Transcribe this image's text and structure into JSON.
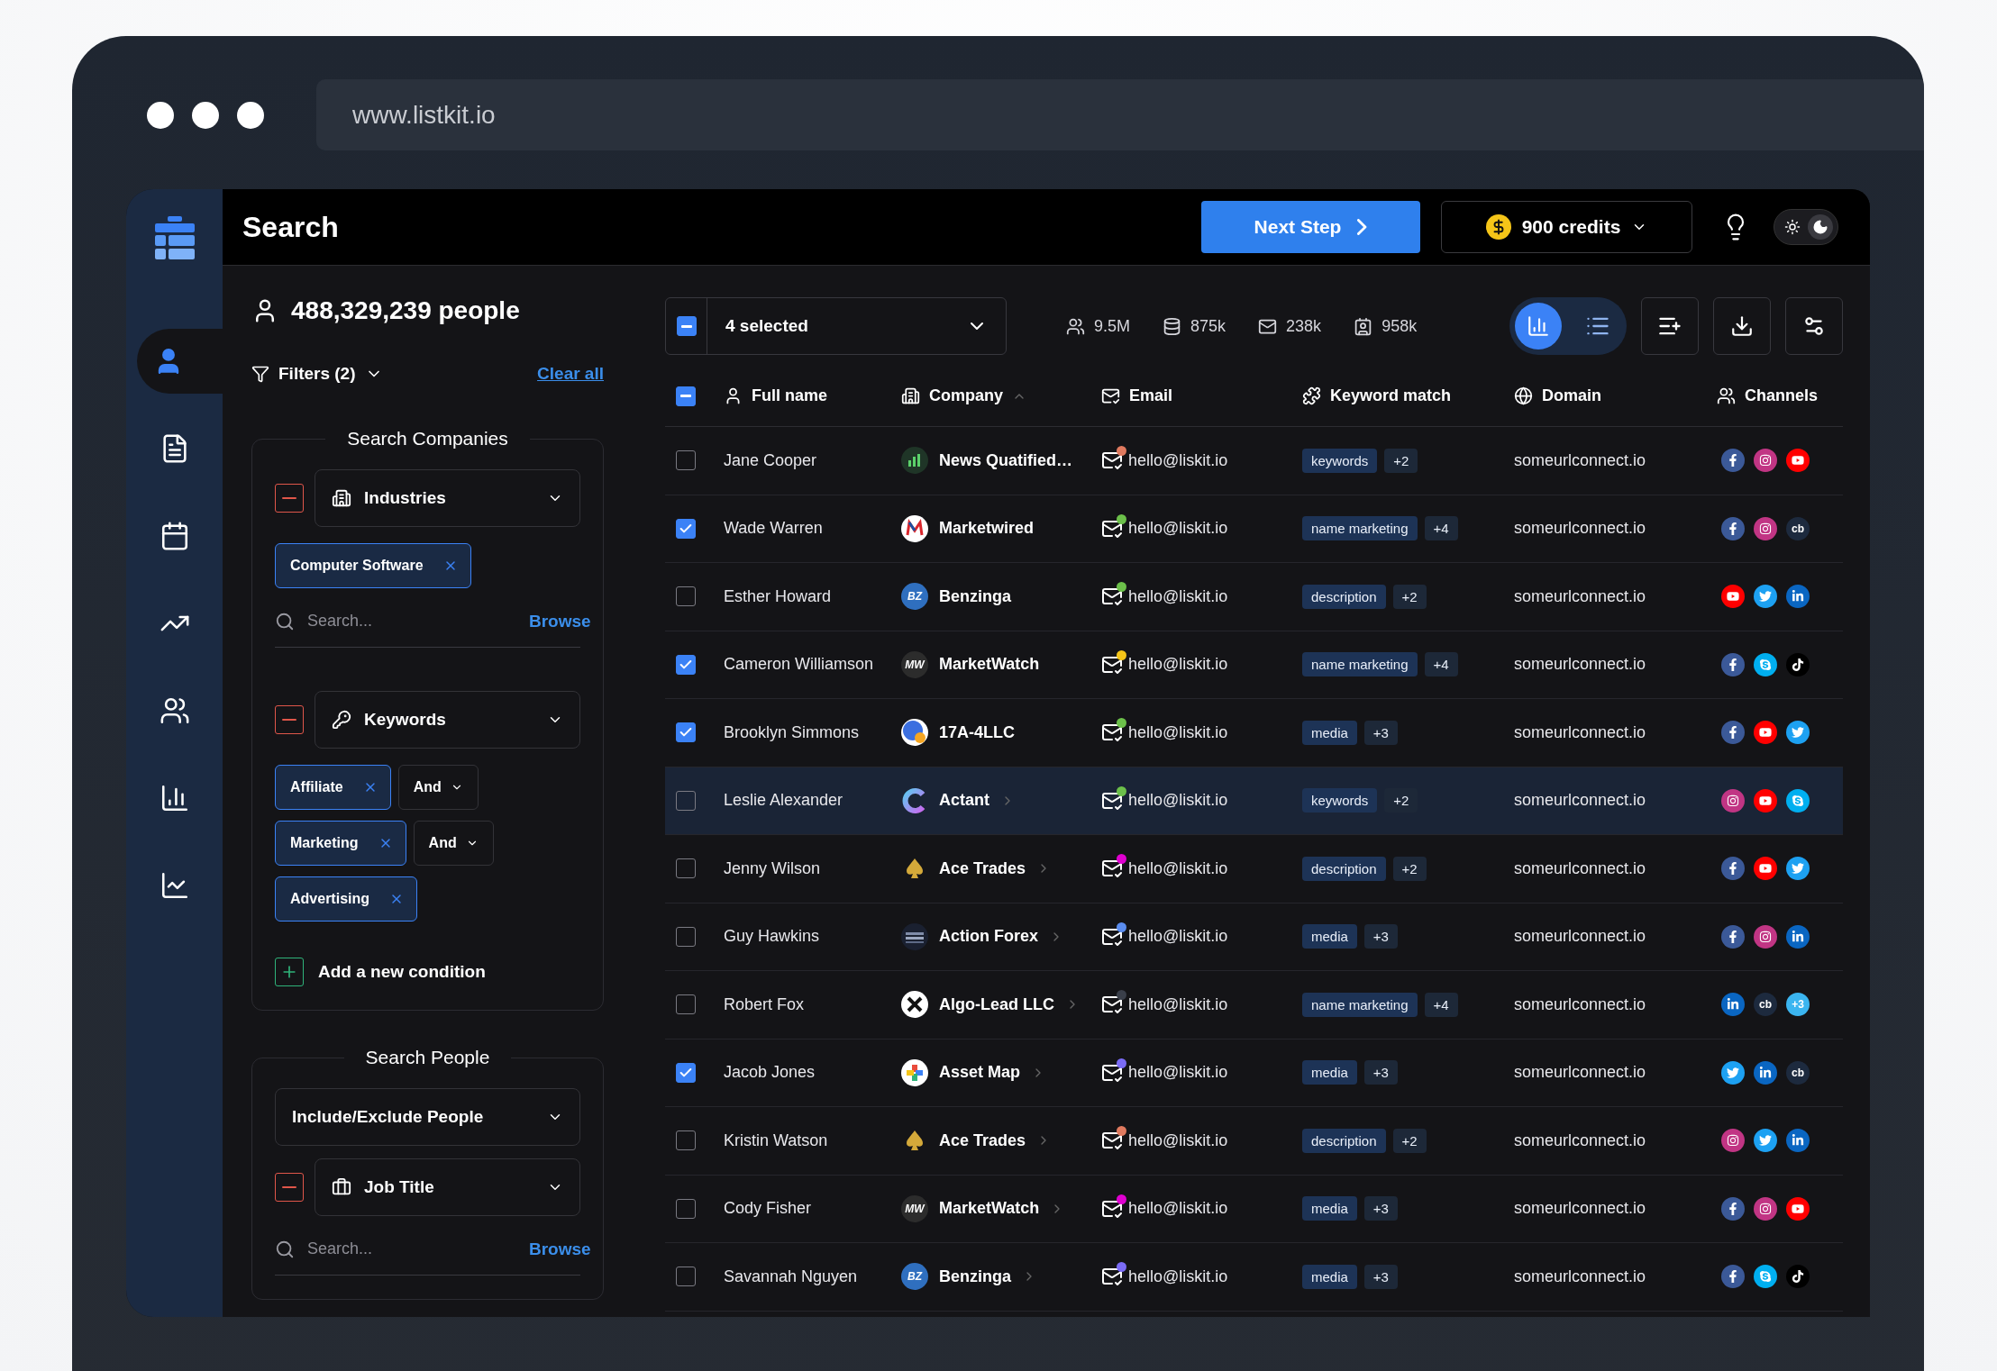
{
  "browser": {
    "url": "www.listkit.io"
  },
  "sidebar": {
    "items": [
      {
        "kind": "person",
        "selected": true
      },
      {
        "kind": "document",
        "selected": false
      },
      {
        "kind": "calendar",
        "selected": false
      },
      {
        "kind": "growth",
        "selected": false
      },
      {
        "kind": "team",
        "selected": false
      },
      {
        "kind": "bars",
        "selected": false
      },
      {
        "kind": "line",
        "selected": false
      }
    ]
  },
  "header": {
    "title": "Search",
    "next_button": "Next Step",
    "credits": "900 credits",
    "dark_mode": true
  },
  "filters_panel": {
    "people_count": "488,329,239 people",
    "filters_label": "Filters (2)",
    "clear_all": "Clear all",
    "sections": [
      {
        "title": "Search Companies",
        "conditions": [
          {
            "kind": "industry",
            "label": "Industries",
            "chips": [
              {
                "label": "Computer Software"
              }
            ],
            "search": {
              "placeholder": "Search...",
              "browse": "Browse"
            }
          },
          {
            "kind": "keyword",
            "label": "Keywords",
            "chips": [
              {
                "label": "Affiliate",
                "operator": "And"
              },
              {
                "label": "Marketing",
                "operator": "And"
              },
              {
                "label": "Advertising"
              }
            ]
          }
        ],
        "add_condition": "Add a new condition"
      },
      {
        "title": "Search People",
        "include_select": "Include/Exclude People",
        "conditions": [
          {
            "kind": "job",
            "label": "Job Title",
            "search": {
              "placeholder": "Search...",
              "browse": "Browse"
            }
          }
        ]
      }
    ]
  },
  "toolbar": {
    "selection": "4 selected",
    "indeterminate": true,
    "stats": [
      {
        "kind": "people",
        "value": "9.5M"
      },
      {
        "kind": "companies",
        "value": "875k"
      },
      {
        "kind": "emails",
        "value": "238k"
      },
      {
        "kind": "contacts",
        "value": "958k"
      }
    ],
    "views": [
      {
        "kind": "chart",
        "selected": true
      },
      {
        "kind": "list",
        "selected": false
      }
    ]
  },
  "table": {
    "indeterminate": true,
    "columns": [
      {
        "kind": "name",
        "label": "Full name",
        "sorted": false
      },
      {
        "kind": "company",
        "label": "Company",
        "sorted": true
      },
      {
        "kind": "email",
        "label": "Email",
        "sorted": false
      },
      {
        "kind": "keyword",
        "label": "Keyword match",
        "sorted": false
      },
      {
        "kind": "domain",
        "label": "Domain",
        "sorted": false
      },
      {
        "kind": "channels",
        "label": "Channels",
        "sorted": false
      }
    ],
    "rows": [
      {
        "selected": false,
        "highlighted": false,
        "name": "Jane Cooper",
        "company": "News Quatified…",
        "logo": {
          "kind": "news"
        },
        "expandable": false,
        "email": "hello@liskit.io",
        "color": "#e07a5f",
        "keyword": "keywords",
        "extra": "+2",
        "domain": "someurlconnect.io",
        "channels": [
          {
            "kind": "facebook"
          },
          {
            "kind": "instagram"
          },
          {
            "kind": "youtube"
          }
        ]
      },
      {
        "selected": true,
        "highlighted": false,
        "name": "Wade Warren",
        "company": "Marketwired",
        "logo": {
          "kind": "marketwired"
        },
        "expandable": false,
        "email": "hello@liskit.io",
        "color": "#6cc04a",
        "keyword": "name marketing",
        "extra": "+4",
        "domain": "someurlconnect.io",
        "channels": [
          {
            "kind": "facebook"
          },
          {
            "kind": "instagram"
          },
          {
            "kind": "text",
            "label": "cb"
          }
        ]
      },
      {
        "selected": false,
        "highlighted": false,
        "name": "Esther Howard",
        "company": "Benzinga",
        "logo": {
          "kind": "monogram",
          "text": "BZ",
          "color": "#2f6fbf"
        },
        "expandable": false,
        "email": "hello@liskit.io",
        "color": "#6cc04a",
        "keyword": "description",
        "extra": "+2",
        "domain": "someurlconnect.io",
        "channels": [
          {
            "kind": "youtube"
          },
          {
            "kind": "twitter"
          },
          {
            "kind": "linkedin"
          }
        ]
      },
      {
        "selected": true,
        "highlighted": false,
        "name": "Cameron Williamson",
        "company": "MarketWatch",
        "logo": {
          "kind": "monogram",
          "text": "MW",
          "color": "#2c2c2c"
        },
        "expandable": false,
        "email": "hello@liskit.io",
        "color": "#f5c518",
        "keyword": "name marketing",
        "extra": "+4",
        "domain": "someurlconnect.io",
        "channels": [
          {
            "kind": "facebook"
          },
          {
            "kind": "skype"
          },
          {
            "kind": "tiktok"
          }
        ]
      },
      {
        "selected": true,
        "highlighted": false,
        "name": "Brooklyn Simmons",
        "company": "17A-4LLC",
        "logo": {
          "kind": "dots"
        },
        "expandable": false,
        "email": "hello@liskit.io",
        "color": "#6cc04a",
        "keyword": "media",
        "extra": "+3",
        "domain": "someurlconnect.io",
        "channels": [
          {
            "kind": "facebook"
          },
          {
            "kind": "youtube"
          },
          {
            "kind": "twitter"
          }
        ]
      },
      {
        "selected": false,
        "highlighted": true,
        "name": "Leslie Alexander",
        "company": "Actant",
        "logo": {
          "kind": "ring"
        },
        "expandable": true,
        "email": "hello@liskit.io",
        "color": "#6cc04a",
        "keyword": "keywords",
        "extra": "+2",
        "domain": "someurlconnect.io",
        "channels": [
          {
            "kind": "instagram"
          },
          {
            "kind": "youtube"
          },
          {
            "kind": "skype"
          }
        ]
      },
      {
        "selected": false,
        "highlighted": false,
        "name": "Jenny Wilson",
        "company": "Ace Trades",
        "logo": {
          "kind": "spade"
        },
        "expandable": true,
        "email": "hello@liskit.io",
        "color": "#e000d0",
        "keyword": "description",
        "extra": "+2",
        "domain": "someurlconnect.io",
        "channels": [
          {
            "kind": "facebook"
          },
          {
            "kind": "youtube"
          },
          {
            "kind": "twitter"
          }
        ]
      },
      {
        "selected": false,
        "highlighted": false,
        "name": "Guy Hawkins",
        "company": "Action Forex",
        "logo": {
          "kind": "stripes"
        },
        "expandable": true,
        "email": "hello@liskit.io",
        "color": "#5b8def",
        "keyword": "media",
        "extra": "+3",
        "domain": "someurlconnect.io",
        "channels": [
          {
            "kind": "facebook"
          },
          {
            "kind": "instagram"
          },
          {
            "kind": "linkedin"
          }
        ]
      },
      {
        "selected": false,
        "highlighted": false,
        "name": "Robert Fox",
        "company": "Algo-Lead LLC",
        "logo": {
          "kind": "cross"
        },
        "expandable": true,
        "email": "hello@liskit.io",
        "color": "#3a3f4a",
        "keyword": "name marketing",
        "extra": "+4",
        "domain": "someurlconnect.io",
        "channels": [
          {
            "kind": "linkedin"
          },
          {
            "kind": "text",
            "label": "cb"
          },
          {
            "kind": "more",
            "label": "+3"
          }
        ]
      },
      {
        "selected": true,
        "highlighted": false,
        "name": "Jacob Jones",
        "company": "Asset Map",
        "logo": {
          "kind": "plus"
        },
        "expandable": true,
        "email": "hello@liskit.io",
        "color": "#7b6cf6",
        "keyword": "media",
        "extra": "+3",
        "domain": "someurlconnect.io",
        "channels": [
          {
            "kind": "twitter"
          },
          {
            "kind": "linkedin"
          },
          {
            "kind": "text",
            "label": "cb"
          }
        ]
      },
      {
        "selected": false,
        "highlighted": false,
        "name": "Kristin Watson",
        "company": "Ace Trades",
        "logo": {
          "kind": "spade"
        },
        "expandable": true,
        "email": "hello@liskit.io",
        "color": "#e07a5f",
        "keyword": "description",
        "extra": "+2",
        "domain": "someurlconnect.io",
        "channels": [
          {
            "kind": "instagram"
          },
          {
            "kind": "twitter"
          },
          {
            "kind": "linkedin"
          }
        ]
      },
      {
        "selected": false,
        "highlighted": false,
        "name": "Cody Fisher",
        "company": "MarketWatch",
        "logo": {
          "kind": "monogram",
          "text": "MW",
          "color": "#2c2c2c"
        },
        "expandable": true,
        "email": "hello@liskit.io",
        "color": "#e000d0",
        "keyword": "media",
        "extra": "+3",
        "domain": "someurlconnect.io",
        "channels": [
          {
            "kind": "facebook"
          },
          {
            "kind": "instagram"
          },
          {
            "kind": "youtube"
          }
        ]
      },
      {
        "selected": false,
        "highlighted": false,
        "name": "Savannah Nguyen",
        "company": "Benzinga",
        "logo": {
          "kind": "monogram",
          "text": "BZ",
          "color": "#2f6fbf"
        },
        "expandable": true,
        "email": "hello@liskit.io",
        "color": "#7b6cf6",
        "keyword": "media",
        "extra": "+3",
        "domain": "someurlconnect.io",
        "channels": [
          {
            "kind": "facebook"
          },
          {
            "kind": "skype"
          },
          {
            "kind": "tiktok"
          }
        ]
      }
    ]
  }
}
